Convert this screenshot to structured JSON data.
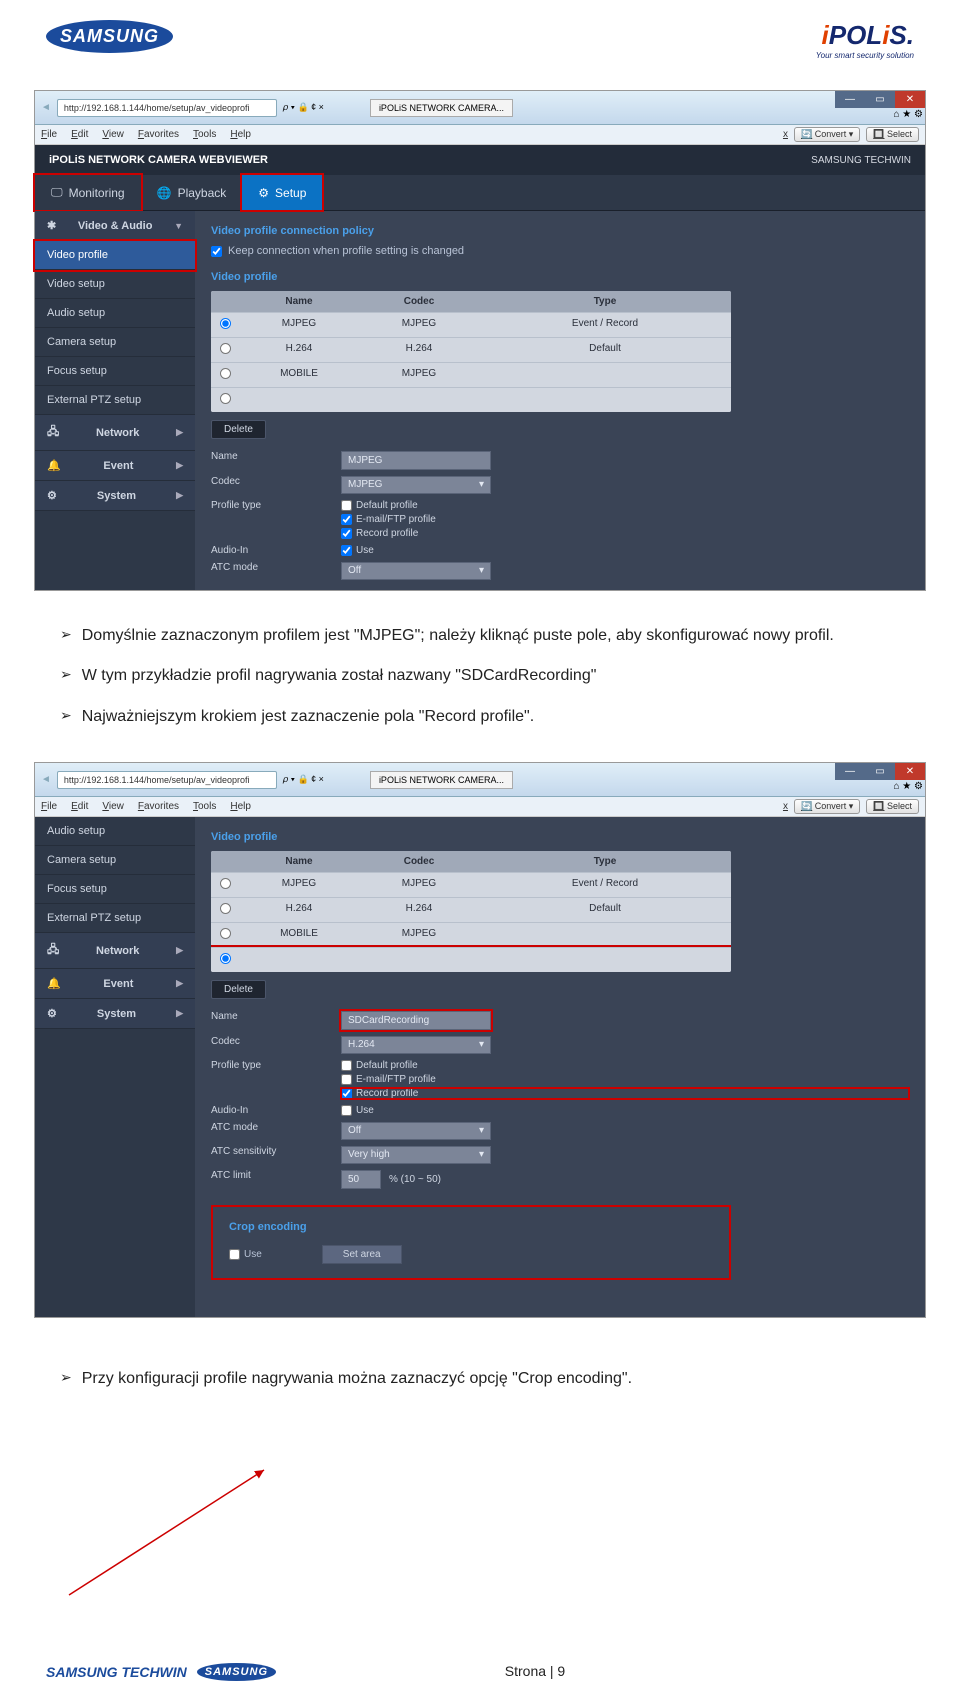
{
  "header": {
    "samsung": "SAMSUNG",
    "ipolis": "iPOLiS",
    "ipolis_tag": "Your smart security solution"
  },
  "browser": {
    "url": "http://192.168.1.144/home/setup/av_videoprofi",
    "tab": "iPOLiS NETWORK CAMERA...",
    "menus": [
      "File",
      "Edit",
      "View",
      "Favorites",
      "Tools",
      "Help"
    ],
    "convert": "Convert",
    "select": "Select",
    "x": "x"
  },
  "webviewer": {
    "title": "iPOLiS NETWORK CAMERA WEBVIEWER",
    "techwin": "SAMSUNG TECHWIN"
  },
  "tabs": {
    "monitoring": "Monitoring",
    "playback": "Playback",
    "setup": "Setup"
  },
  "sidebar": {
    "video_audio": "Video & Audio",
    "video_profile": "Video profile",
    "video_setup": "Video setup",
    "audio_setup": "Audio setup",
    "camera_setup": "Camera setup",
    "focus_setup": "Focus setup",
    "external_ptz": "External PTZ setup",
    "network": "Network",
    "event": "Event",
    "system": "System"
  },
  "s1": {
    "policy_head": "Video profile connection policy",
    "keep_conn": "Keep connection when profile setting is changed",
    "profile_head": "Video profile",
    "th_name": "Name",
    "th_codec": "Codec",
    "th_type": "Type",
    "rows": [
      {
        "name": "MJPEG",
        "codec": "MJPEG",
        "type": "Event / Record"
      },
      {
        "name": "H.264",
        "codec": "H.264",
        "type": "Default"
      },
      {
        "name": "MOBILE",
        "codec": "MJPEG",
        "type": ""
      }
    ],
    "delete": "Delete",
    "f_name": "Name",
    "f_name_v": "MJPEG",
    "f_codec": "Codec",
    "f_codec_v": "MJPEG",
    "f_ptype": "Profile type",
    "pt_default": "Default profile",
    "pt_email": "E-mail/FTP profile",
    "pt_record": "Record profile",
    "f_audio": "Audio-In",
    "use": "Use",
    "f_atc": "ATC mode",
    "off": "Off"
  },
  "s2": {
    "profile_head": "Video profile",
    "th_name": "Name",
    "th_codec": "Codec",
    "th_type": "Type",
    "rows": [
      {
        "name": "MJPEG",
        "codec": "MJPEG",
        "type": "Event / Record"
      },
      {
        "name": "H.264",
        "codec": "H.264",
        "type": "Default"
      },
      {
        "name": "MOBILE",
        "codec": "MJPEG",
        "type": ""
      }
    ],
    "delete": "Delete",
    "f_name": "Name",
    "f_name_v": "SDCardRecording",
    "f_codec": "Codec",
    "f_codec_v": "H.264",
    "f_ptype": "Profile type",
    "pt_default": "Default profile",
    "pt_email": "E-mail/FTP profile",
    "pt_record": "Record profile",
    "f_audio": "Audio-In",
    "use": "Use",
    "f_atc": "ATC mode",
    "off": "Off",
    "f_atcs": "ATC sensitivity",
    "vh": "Very high",
    "f_atcl": "ATC limit",
    "lim": "50",
    "limr": "% (10 ~ 50)",
    "crop": "Crop encoding",
    "setarea": "Set area"
  },
  "doc": {
    "b1": "Domyślnie zaznaczonym profilem jest \"MJPEG\"; należy kliknąć puste pole, aby skonfigurować nowy profil.",
    "b2": "W tym przykładzie profil nagrywania został nazwany \"SDCardRecording\"",
    "b3": "Najważniejszym krokiem jest zaznaczenie pola \"Record profile\".",
    "b4": "Przy konfiguracji profile nagrywania można zaznaczyć opcję \"Crop encoding\"."
  },
  "footer": {
    "st": "SAMSUNG TECHWIN",
    "page": "Strona | 9"
  }
}
